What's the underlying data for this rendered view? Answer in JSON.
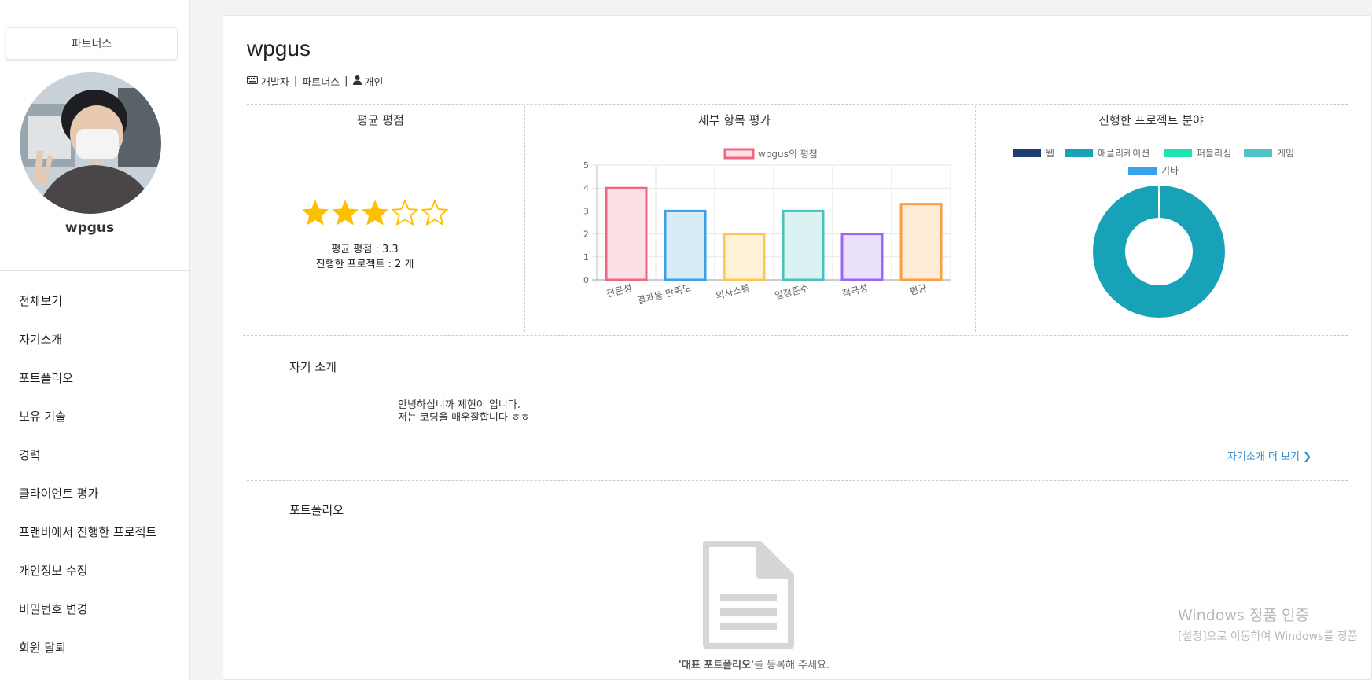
{
  "sidebar": {
    "role_badge": "파트너스",
    "username": "wpgus",
    "nav": [
      "전체보기",
      "자기소개",
      "포트폴리오",
      "보유 기술",
      "경력",
      "클라이언트 평가",
      "프랜비에서 진행한 프로젝트",
      "개인정보 수정",
      "비밀번호 변경",
      "회원 탈퇴"
    ]
  },
  "profile": {
    "name": "wpgus",
    "role": "개발자",
    "type": "파트너스",
    "kind": "개인",
    "separator": "|"
  },
  "rating": {
    "title": "평균 평점",
    "stars_filled": 3,
    "stars_total": 5,
    "avg_line": "평균 평점 : 3.3",
    "projects_line": "진행한 프로젝트 : 2 개"
  },
  "detail": {
    "title": "세부 항목 평가"
  },
  "field": {
    "title": "진행한 프로젝트 분야"
  },
  "intro": {
    "title": "자기 소개",
    "line1": "안녕하십니까 제현이 입니다.",
    "line2": "저는 코딩을 매우잘합니다 ㅎㅎ",
    "more": "자기소개 더 보기 ❯"
  },
  "portfolio": {
    "title": "포트폴리오",
    "empty_bold": "'대표 포트폴리오'",
    "empty_rest": "를 등록해 주세요."
  },
  "watermark": {
    "line1": "Windows 정품 인증",
    "line2": "[설정]으로 이동하여 Windows를 정품"
  },
  "chart_data": [
    {
      "type": "bar",
      "categories": [
        "전문성",
        "결과물 만족도",
        "의사소통",
        "일정준수",
        "적극성",
        "평균"
      ],
      "series": [
        {
          "name": "wpgus의 평점",
          "values": [
            4,
            3,
            2,
            3,
            2,
            3.3
          ]
        }
      ],
      "ylim": [
        0,
        5
      ],
      "yticks": [
        0,
        1,
        2,
        3,
        4,
        5
      ],
      "colors": [
        "#f0657f",
        "#3ba1e2",
        "#fcc757",
        "#4cbfbf",
        "#9a67f5",
        "#fa9f40"
      ],
      "fills": [
        "#fde0e6",
        "#d7ebf9",
        "#fff3d7",
        "#dbf2f2",
        "#ebe1fd",
        "#feebd8"
      ],
      "legend": "top",
      "grid": true
    },
    {
      "type": "pie",
      "categories": [
        "웹",
        "애플리케이션",
        "퍼블리싱",
        "게임",
        "기타"
      ],
      "values": [
        0,
        2,
        0,
        0,
        0
      ],
      "colors": [
        "#1e3d73",
        "#17a2b8",
        "#20e3b2",
        "#4fc3c7",
        "#36a2eb"
      ],
      "legend": "top"
    }
  ]
}
